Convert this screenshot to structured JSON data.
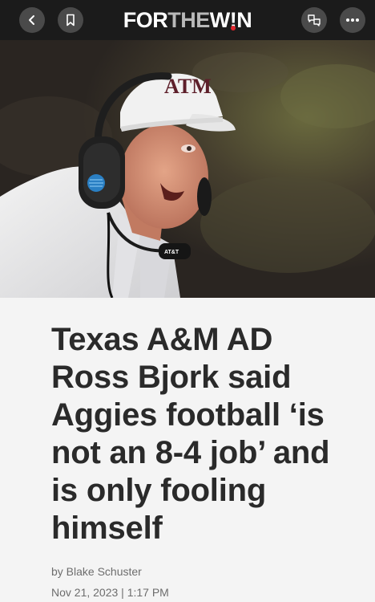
{
  "topbar": {
    "logo_part_white": "FOR",
    "logo_part_gray": "THE",
    "logo_part_w": "W",
    "logo_part_i": "!",
    "logo_part_n": "N",
    "icons": [
      "back-chevron-icon",
      "bookmark-icon",
      "reaction-icon",
      "more-icon"
    ],
    "accent_dot_color": "#e0262c"
  },
  "hero": {
    "cap_logo_text": "ATM",
    "mic_text": "AT&T"
  },
  "article": {
    "headline": "Texas A&M AD Ross Bjork said Aggies football ‘is not an 8-4 job’ and is only fooling himself",
    "byline": "by Blake Schuster",
    "date": "Nov 21, 2023 | 1:17 PM"
  }
}
